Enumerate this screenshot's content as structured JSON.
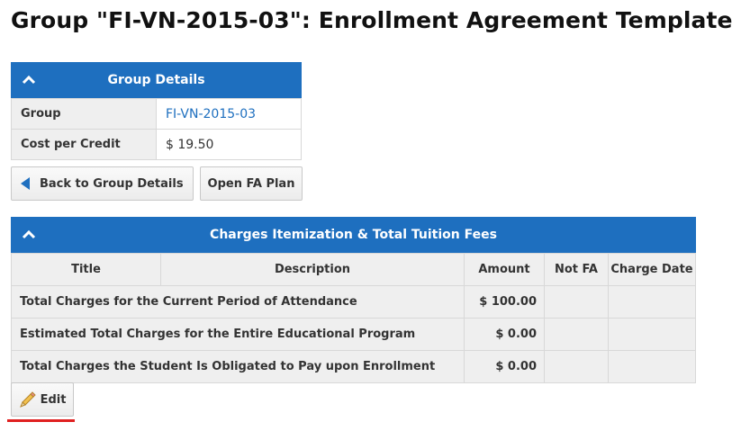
{
  "page": {
    "title": "Group \"FI-VN-2015-03\": Enrollment Agreement Template"
  },
  "group_details": {
    "header": "Group Details",
    "rows": [
      {
        "label": "Group",
        "value": "FI-VN-2015-03"
      },
      {
        "label": "Cost per Credit",
        "value": "$ 19.50"
      }
    ]
  },
  "buttons": {
    "back": "Back to Group Details",
    "open_fa": "Open FA Plan",
    "edit": "Edit"
  },
  "charges": {
    "header": "Charges Itemization & Total Tuition Fees",
    "columns": [
      "Title",
      "Description",
      "Amount",
      "Not FA",
      "Charge Date"
    ],
    "rows": [
      {
        "title": "Total Charges for the Current Period of Attendance",
        "amount": "$ 100.00"
      },
      {
        "title": "Estimated Total Charges for the Entire Educational Program",
        "amount": "$ 0.00"
      },
      {
        "title": "Total Charges the Student Is Obligated to Pay upon Enrollment",
        "amount": "$ 0.00"
      }
    ]
  },
  "colors": {
    "header_blue": "#1e6fbf",
    "highlight_red": "#e02020"
  }
}
